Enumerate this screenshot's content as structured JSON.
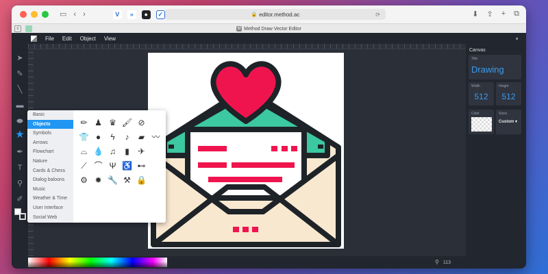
{
  "browser": {
    "url": "editor.method.ac",
    "tab_title": "Method Draw Vector Editor"
  },
  "menu": [
    "File",
    "Edit",
    "Object",
    "View"
  ],
  "panel": {
    "heading": "Canvas",
    "title_label": "Title",
    "title_value": "Drawing",
    "width_label": "Width",
    "width_value": "512",
    "height_label": "Height",
    "height_value": "512",
    "color_label": "Color",
    "sizes_label": "Sizes",
    "sizes_value": "Custom"
  },
  "library": {
    "categories": [
      "Basic",
      "Objects",
      "Symbols",
      "Arrows",
      "Flowchart",
      "Nature",
      "Cards & Chess",
      "Dialog baloons",
      "Music",
      "Weather & Time",
      "User Interface",
      "Social Web"
    ],
    "selected": "Objects",
    "shapes": [
      "pencil-icon",
      "person-icon",
      "trophy-icon",
      "brush-icon",
      "paperclip-icon",
      "",
      "shirt-icon",
      "circle-icon",
      "lightning-icon",
      "guitar-icon",
      "car-icon",
      "mustache-icon",
      "hat-icon",
      "drop-icon",
      "guitar-2-icon",
      "bottle-icon",
      "helicopter-icon",
      "",
      "wand-icon",
      "boomerang-icon",
      "menorah-icon",
      "wheelchair-icon",
      "bone-icon",
      "",
      "gear-icon",
      "gear-2-icon",
      "wrench-icon",
      "hammer-icon",
      "lock-icon",
      ""
    ]
  },
  "zoom": "113",
  "colors": {
    "accent": "#2196f3",
    "heart": "#f0144e",
    "teal": "#3cc8a0",
    "cream": "#f9e8d0",
    "outline": "#1e2328"
  }
}
